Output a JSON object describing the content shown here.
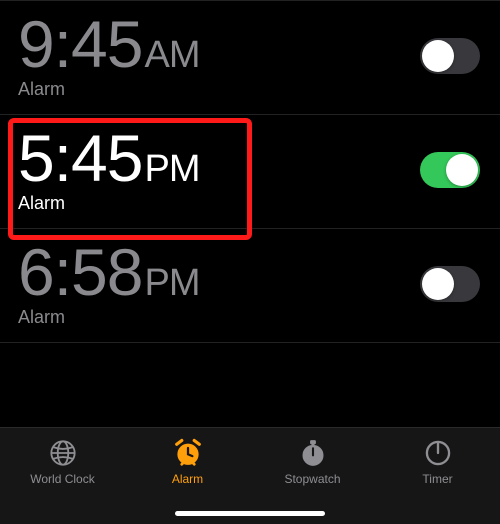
{
  "alarms": [
    {
      "time": "9:45",
      "ampm": "AM",
      "label": "Alarm",
      "enabled": false,
      "highlighted": false
    },
    {
      "time": "5:45",
      "ampm": "PM",
      "label": "Alarm",
      "enabled": true,
      "highlighted": true
    },
    {
      "time": "6:58",
      "ampm": "PM",
      "label": "Alarm",
      "enabled": false,
      "highlighted": false
    }
  ],
  "tabs": {
    "world_clock": "World Clock",
    "alarm": "Alarm",
    "stopwatch": "Stopwatch",
    "timer": "Timer"
  },
  "active_tab": "alarm",
  "colors": {
    "accent": "#ff9f0a",
    "toggle_on": "#34c759",
    "inactive_text": "#8a8a8e",
    "highlight": "#ff1a1a"
  }
}
